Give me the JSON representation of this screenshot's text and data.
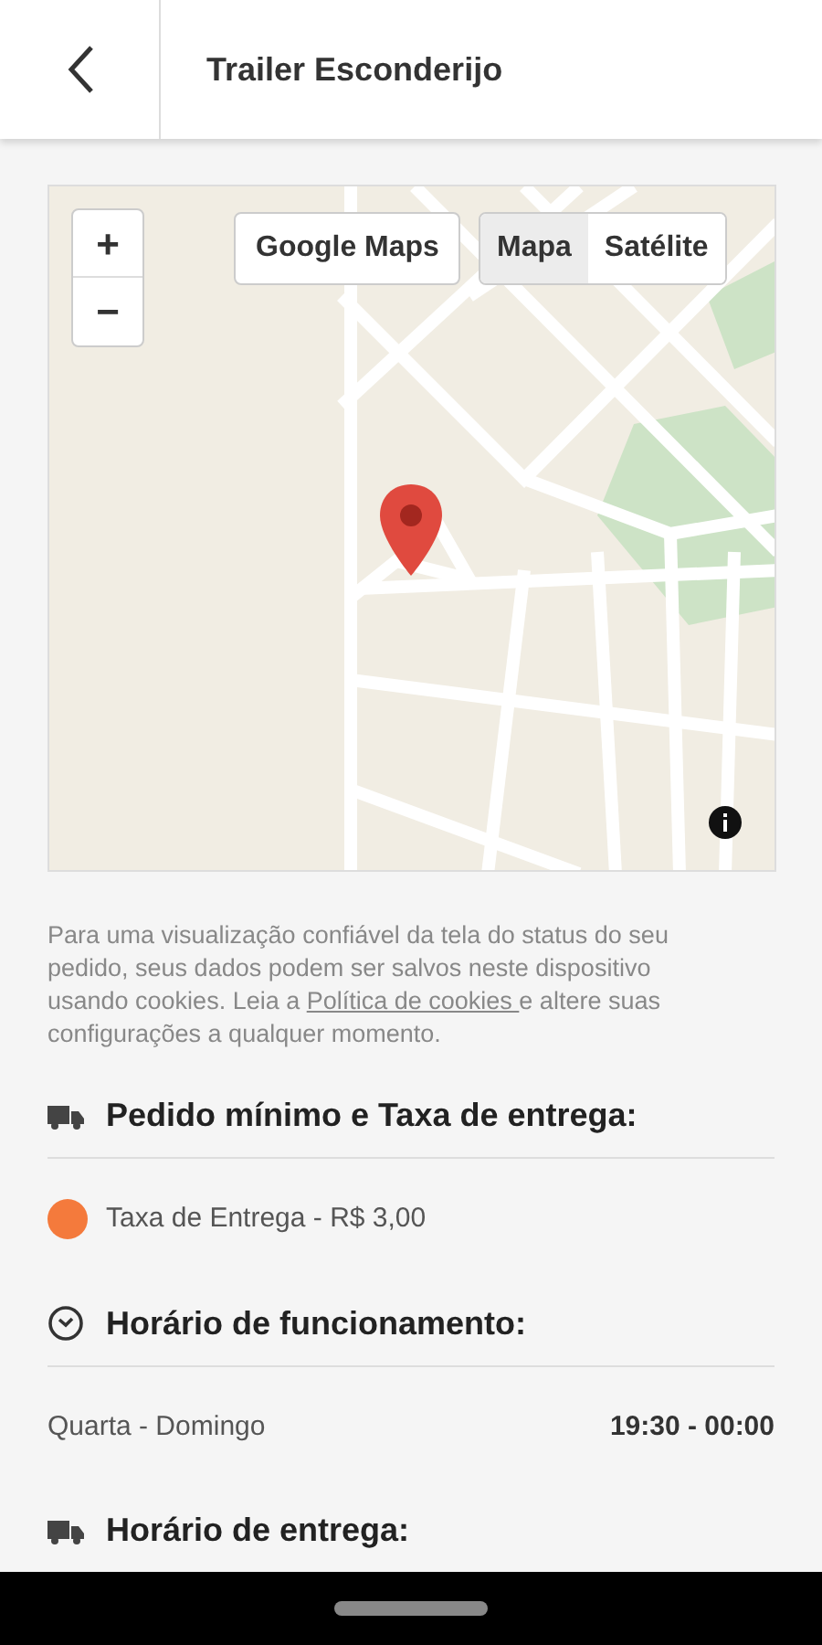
{
  "header": {
    "title": "Trailer Esconderijo"
  },
  "map": {
    "zoom_in": "+",
    "zoom_out": "−",
    "google_maps_button": "Google Maps",
    "map_types": [
      {
        "label": "Mapa",
        "selected": true
      },
      {
        "label": "Satélite",
        "selected": false
      }
    ]
  },
  "cookie_notice": {
    "before": "Para uma visualização confiável da tela do status do seu pedido, seus dados podem ser salvos neste dispositivo usando cookies. Leia a ",
    "link": "Política de cookies ",
    "after": "e altere suas configurações a qualquer momento."
  },
  "sections": [
    {
      "kind": "delivery",
      "title": "Pedido mínimo e Taxa de entrega:",
      "rows": [
        {
          "kind": "fee",
          "label": "Taxa de Entrega - R$ 3,00",
          "color": "#f47a3c"
        }
      ]
    },
    {
      "kind": "clock",
      "title": "Horário de funcionamento:",
      "rows": [
        {
          "kind": "hours",
          "label": "Quarta - Domingo",
          "value": "19:30 - 00:00"
        }
      ]
    },
    {
      "kind": "delivery",
      "title": "Horário de entrega:"
    }
  ]
}
